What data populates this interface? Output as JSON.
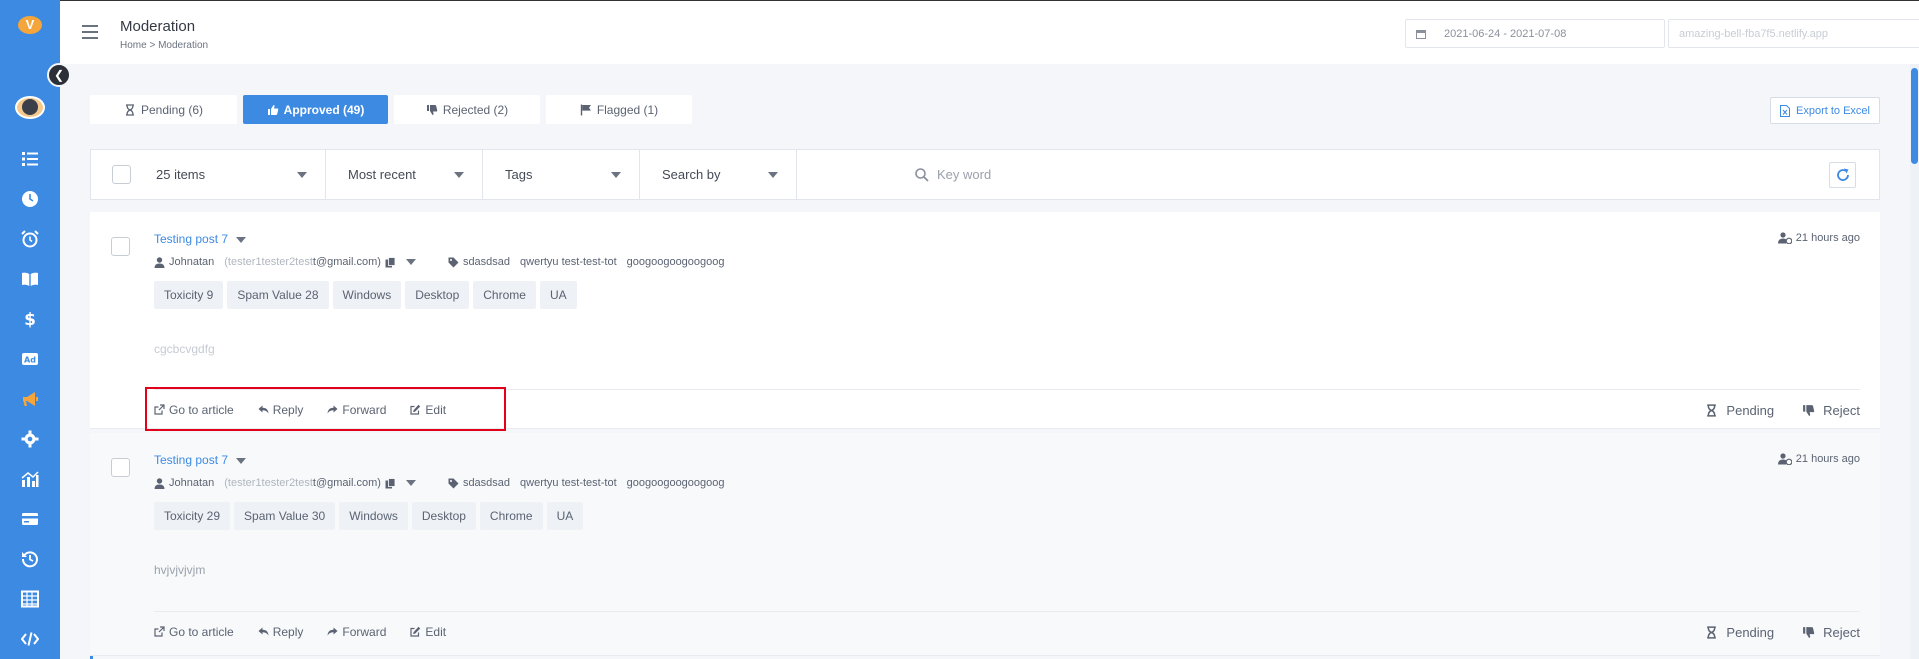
{
  "sidebar": {
    "logo_text": "V",
    "items": [
      {
        "name": "list-icon"
      },
      {
        "name": "clock-icon"
      },
      {
        "name": "alarm-icon"
      },
      {
        "name": "book-icon"
      },
      {
        "name": "dollar-icon"
      },
      {
        "name": "ad-icon",
        "label": "Ad"
      },
      {
        "name": "megaphone-icon",
        "active": true
      },
      {
        "name": "gear-icon"
      },
      {
        "name": "chart-icon"
      },
      {
        "name": "card-icon"
      },
      {
        "name": "history-icon"
      },
      {
        "name": "table-icon"
      },
      {
        "name": "code-icon"
      }
    ]
  },
  "header": {
    "title": "Moderation",
    "breadcrumb": "Home  >  Moderation",
    "date_range": "2021-06-24 - 2021-07-08",
    "site": "amazing-bell-fba7f5.netlify.app"
  },
  "tabs": [
    {
      "label": "Pending (6)",
      "icon": "hourglass-icon"
    },
    {
      "label": "Approved (49)",
      "icon": "thumbs-up-icon",
      "active": true
    },
    {
      "label": "Rejected (2)",
      "icon": "thumbs-down-icon"
    },
    {
      "label": "Flagged (1)",
      "icon": "flag-icon"
    }
  ],
  "export_label": "Export to Excel",
  "filters": {
    "items": "25 items",
    "sort": "Most recent",
    "tags": "Tags",
    "search_by": "Search by",
    "keyword_placeholder": "Key word"
  },
  "posts": [
    {
      "title": "Testing post 7",
      "time": "21 hours ago",
      "author": "Johnatan",
      "email_prefix": "(tester1tester2test",
      "email_suffix": "t@gmail.com)",
      "tags": [
        "sdasdsad",
        "qwertyu test-test-tot",
        "googoogoogoogoog"
      ],
      "chips": [
        "Toxicity 9",
        "Spam Value 28",
        "Windows",
        "Desktop",
        "Chrome",
        "UA"
      ],
      "body": "cgcbcvgdfg"
    },
    {
      "title": "Testing post 7",
      "time": "21 hours ago",
      "author": "Johnatan",
      "email_prefix": "(tester1tester2test",
      "email_suffix": "t@gmail.com)",
      "tags": [
        "sdasdsad",
        "qwertyu test-test-tot",
        "googoogoogoogoog"
      ],
      "chips": [
        "Toxicity 29",
        "Spam Value 30",
        "Windows",
        "Desktop",
        "Chrome",
        "UA"
      ],
      "body": "hvjvjvjvjm"
    }
  ],
  "actions": {
    "go_to_article": "Go to article",
    "reply": "Reply",
    "forward": "Forward",
    "edit": "Edit",
    "pending": "Pending",
    "reject": "Reject"
  },
  "colors": {
    "accent": "#3d8ae3",
    "active_nav": "#f4a53c",
    "highlight": "#e3001b"
  }
}
